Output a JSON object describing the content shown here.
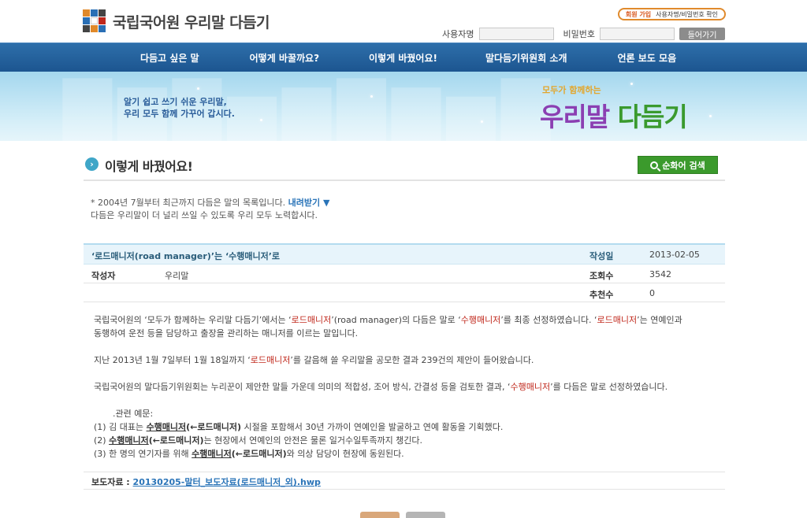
{
  "header": {
    "site_title": "국립국어원 우리말 다듬기",
    "util": {
      "join": "회원 가입",
      "find": "사용자명/비밀번호 확인"
    },
    "login": {
      "user_label": "사용자명",
      "pass_label": "비밀번호",
      "submit": "들어가기",
      "user_value": "",
      "pass_value": ""
    }
  },
  "nav": {
    "items": [
      "다듬고 싶은 말",
      "어떻게 바꿀까요?",
      "이렇게 바꿨어요!",
      "말다듬기위원회 소개",
      "언론 보도 모음"
    ]
  },
  "banner": {
    "slogan_line1": "알기 쉽고 쓰기 쉬운 우리말,",
    "slogan_line2": "우리 모두 함께 가꾸어 갑시다.",
    "brand_sub": "모두가 함께하는",
    "brand_main_1": "우리말",
    "brand_main_2": "다듬기"
  },
  "page": {
    "title": "이렇게 바꿨어요!",
    "search_button": "순화어 검색",
    "notice_line1": "* 2004년 7월부터 최근까지 다듬은 말의 목록입니다.",
    "download_link": "내려받기 ▼",
    "notice_line2": "다듬은 우리말이 더 널리 쓰일 수 있도록 우리 모두 노력합시다."
  },
  "post": {
    "title": "‘로드매니저(road manager)’는 ‘수행매니저’로",
    "date_label": "작성일",
    "date": "2013-02-05",
    "author_label": "작성자",
    "author": "우리말",
    "views_label": "조회수",
    "views": "3542",
    "recommend_label": "추천수",
    "recommend": "0",
    "p1_a": "국립국어원의 ‘모두가 함께하는 우리말 다듬기’에서는 ‘",
    "p1_h1": "로드매니저",
    "p1_b": "’(road manager)의 다듬은 말로 ‘",
    "p1_h2": "수행매니저",
    "p1_c": "’를 최종 선정하였습니다. ‘",
    "p1_h3": "로드매니저",
    "p1_d": "’는 연예인과",
    "p1_line2": "동행하여 운전 등을 담당하고 출장을 관리하는 매니저를 이르는 말입니다.",
    "p2_a": "지난 2013년 1월 7일부터 1월 18일까지 ‘",
    "p2_h": "로드매니저",
    "p2_b": "’를 갈음해 쓸 우리말을 공모한 결과 239건의 제안이 들어왔습니다.",
    "p3_a": "국립국어원의 말다듬기위원회는 누리꾼이 제안한 말들 가운데 의미의 적합성, 조어 방식, 간결성 등을 검토한 결과, ‘",
    "p3_h": "수행매니저",
    "p3_b": "’를 다듬은 말로 선정하였습니다.",
    "examples_title": ".관련 예문:",
    "ex1_a": "(1)  김 대표는 ",
    "ex1_u": "수행매니저",
    "ex1_b": "(←로드매니저)",
    "ex1_c": " 시절을 포함해서 30년 가까이 연예인을 발굴하고 연예 활동을 기획했다.",
    "ex2_a": "(2) ",
    "ex2_u": "수행매니저",
    "ex2_b": "(←로드매니저)",
    "ex2_c": "는 현장에서 연예인의 안전은 물론 일거수일투족까지 챙긴다.",
    "ex3_a": "(3) 한 명의 연기자를 위해 ",
    "ex3_u": "수행매니저",
    "ex3_b": "(←로드매니저)",
    "ex3_c": "와 의상 담당이 현장에 동원된다.",
    "attach_label": "보도자료 : ",
    "attach_file": "20130205-말터_보도자료(로드매니저_외).hwp"
  },
  "colors": {
    "nav": "#1c5590",
    "accent_green": "#3b9a2c",
    "highlight_red": "#c0281c",
    "link_blue": "#2a74b8"
  }
}
